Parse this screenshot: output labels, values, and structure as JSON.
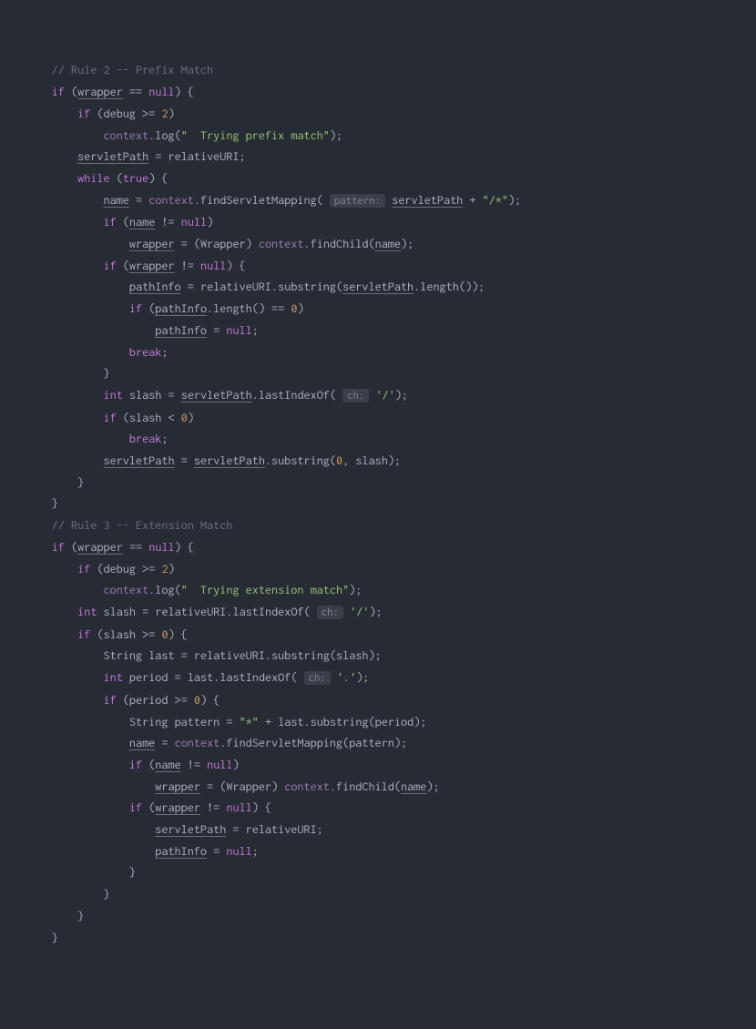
{
  "c": {
    "rule2": "// Rule 2 -- Prefix Match",
    "if": "if",
    "while": "while",
    "int": "int",
    "break": "break",
    "true": "true",
    "null": "null",
    "wrapper": "wrapper",
    "debug": "debug",
    "context": "context",
    "log": "log",
    "tryprefix": "\"  Trying prefix match\"",
    "servletPath": "servletPath",
    "relativeURI": "relativeURI",
    "name": "name",
    "findServletMapping": "findServletMapping",
    "hint_pattern": "pattern:",
    "plus": "+",
    "slashstar": "\"/*\"",
    "Wrapper": "Wrapper",
    "findChild": "findChild",
    "pathInfo": "pathInfo",
    "substring": "substring",
    "length": "length",
    "slash": "slash",
    "lastIndexOf": "lastIndexOf",
    "hint_ch": "ch:",
    "ch_slash": "'/'",
    "ch_dot": "'.'",
    "rule3": "// Rule 3 -- Extension Match",
    "tryext": "\"  Trying extension match\"",
    "String": "String",
    "last": "last",
    "period": "period",
    "pattern": "pattern",
    "star": "\"*\"",
    "n0": "0",
    "n2": "2",
    "eq": "==",
    "ne": "!=",
    "ge": ">=",
    "lt": "<",
    "as": "="
  }
}
